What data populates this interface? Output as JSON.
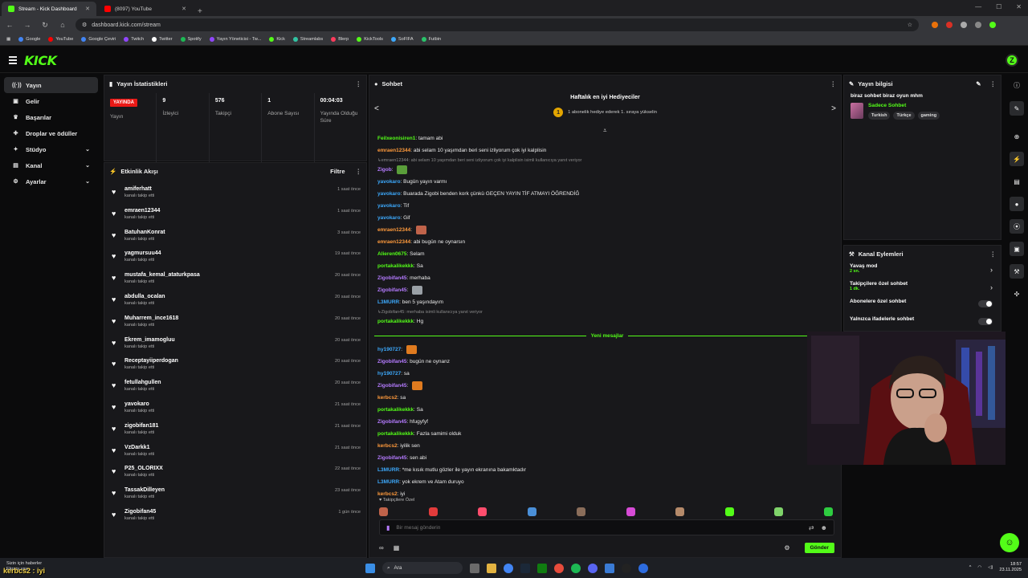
{
  "browser": {
    "tabs": [
      {
        "title": "Stream - Kick Dashboard",
        "color": "#53fc18",
        "active": true
      },
      {
        "title": "(8097) YouTube",
        "color": "#ff0000",
        "active": false
      }
    ],
    "url": "dashboard.kick.com/stream",
    "bookmarks": [
      {
        "label": "Google",
        "color": "#4285f4"
      },
      {
        "label": "YouTube",
        "color": "#ff0000"
      },
      {
        "label": "Google Çeviri",
        "color": "#4285f4"
      },
      {
        "label": "Twitch",
        "color": "#9146ff"
      },
      {
        "label": "Twitter",
        "color": "#ffffff"
      },
      {
        "label": "Spotify",
        "color": "#1db954"
      },
      {
        "label": "Yayın Yöneticisi - Tw...",
        "color": "#9146ff"
      },
      {
        "label": "Kick",
        "color": "#53fc18"
      },
      {
        "label": "Streamlabs",
        "color": "#31c3a2"
      },
      {
        "label": "Blerp",
        "color": "#ff3b5c"
      },
      {
        "label": "KickTools",
        "color": "#53fc18"
      },
      {
        "label": "SoFIFA",
        "color": "#3da9fc"
      },
      {
        "label": "Futbin",
        "color": "#29c36a"
      }
    ]
  },
  "sidebar": {
    "items": [
      {
        "label": "Yayın",
        "icon": "broadcast-icon",
        "symbol": "((·))",
        "active": true,
        "chevron": false
      },
      {
        "label": "Gelir",
        "icon": "revenue-icon",
        "symbol": "▣",
        "active": false,
        "chevron": false
      },
      {
        "label": "Başarılar",
        "icon": "trophy-icon",
        "symbol": "♛",
        "active": false,
        "chevron": false
      },
      {
        "label": "Droplar ve ödüller",
        "icon": "gift-icon",
        "symbol": "✚",
        "active": false,
        "chevron": false
      },
      {
        "label": "Stüdyo",
        "icon": "studio-icon",
        "symbol": "✦",
        "active": false,
        "chevron": true
      },
      {
        "label": "Kanal",
        "icon": "channel-icon",
        "symbol": "▤",
        "active": false,
        "chevron": true
      },
      {
        "label": "Ayarlar",
        "icon": "settings-icon",
        "symbol": "⚙",
        "active": false,
        "chevron": true
      }
    ]
  },
  "stats": {
    "title": "Yayın İstatistikleri",
    "items": [
      {
        "value": "YAYINDA",
        "label": "Yayın",
        "badge": true
      },
      {
        "value": "9",
        "label": "İzleyici",
        "badge": false
      },
      {
        "value": "576",
        "label": "Takipçi",
        "badge": false
      },
      {
        "value": "1",
        "label": "Abone Sayısı",
        "badge": false
      },
      {
        "value": "00:04:03",
        "label": "Yayında Olduğu Süre",
        "badge": false
      }
    ]
  },
  "activity": {
    "title": "Etkinlik Akışı",
    "filter": "Filtre",
    "sub": "kanalı takip etti",
    "rows": [
      {
        "name": "amiferhatt",
        "time": "1 saat önce"
      },
      {
        "name": "emraen12344",
        "time": "1 saat önce"
      },
      {
        "name": "BatuhanKonrat",
        "time": "3 saat önce"
      },
      {
        "name": "yagmursuu44",
        "time": "19 saat önce"
      },
      {
        "name": "mustafa_kemal_ataturkpasa",
        "time": "20 saat önce"
      },
      {
        "name": "abdulla_ocalan",
        "time": "20 saat önce"
      },
      {
        "name": "Muharrem_ince1618",
        "time": "20 saat önce"
      },
      {
        "name": "Ekrem_imamogluu",
        "time": "20 saat önce"
      },
      {
        "name": "Receptayiiperdogan",
        "time": "20 saat önce"
      },
      {
        "name": "fetullahgullen",
        "time": "20 saat önce"
      },
      {
        "name": "yavokaro",
        "time": "21 saat önce"
      },
      {
        "name": "zigobifan181",
        "time": "21 saat önce"
      },
      {
        "name": "VzDarkk1",
        "time": "21 saat önce"
      },
      {
        "name": "P25_OLORIXX",
        "time": "22 saat önce"
      },
      {
        "name": "TassakDilleyen",
        "time": "23 saat önce"
      },
      {
        "name": "Zigobifan45",
        "time": "1 gün önce"
      }
    ]
  },
  "chat": {
    "title": "Sohbet",
    "gifters_title": "Haftalık en iyi Hediyeciler",
    "gifters_rank": "1",
    "gifters_text": "1 abonelik hediye ederek 1. sıraya yükselin",
    "messages": [
      {
        "user": "Feilxeonisiren1",
        "color": "#53fc18",
        "text": "tamam abi"
      },
      {
        "user": "emraen12344",
        "color": "#ff9a3c",
        "text": "abi selam 10 yaşımdan beri seni izliyorum çok iyi kalplisin"
      },
      {
        "reply": "emraen12344: abi selam 10 yaşımdan beri seni izliyorum çok iyi kalplisin isimli kullanıcıya yanıt veriyor"
      },
      {
        "user": "Zigob",
        "color": "#b57bff",
        "text": "",
        "emote": "#5a9e3a"
      },
      {
        "user": "yavokaro",
        "color": "#3da9fc",
        "text": "Bugün yayın varmı"
      },
      {
        "user": "yavokaro",
        "color": "#3da9fc",
        "text": "Buarada Zigobi benden kork çünkü GEÇEN YAYIN TİF ATMAYI ÖĞRENDİĞ"
      },
      {
        "user": "yavokaro",
        "color": "#3da9fc",
        "text": "Tif"
      },
      {
        "user": "yavokaro",
        "color": "#3da9fc",
        "text": "Gif"
      },
      {
        "user": "emraen12344",
        "color": "#ff9a3c",
        "text": "",
        "emote": "#c0634a"
      },
      {
        "user": "emraen12344",
        "color": "#ff9a3c",
        "text": "abi bugün ne oynarsın"
      },
      {
        "user": "Alieren0675",
        "color": "#53fc18",
        "text": "Selam"
      },
      {
        "user": "portakalikekkk",
        "color": "#53fc18",
        "text": "Sa"
      },
      {
        "user": "Zigobifan45",
        "color": "#b57bff",
        "text": "merhaba"
      },
      {
        "user": "Zigobifan45",
        "color": "#b57bff",
        "text": "",
        "emote": "#9aa0a6"
      },
      {
        "user": "L3MURR",
        "color": "#3da9fc",
        "text": "ben 5 yaşındayım"
      },
      {
        "reply": "Zigobifan45: merhaba isimli kullanıcıya yanıt veriyor"
      },
      {
        "user": "portakalikekkk",
        "color": "#53fc18",
        "text": "Hg"
      },
      {
        "separator": "Yeni mesajlar"
      },
      {
        "user": "hy190727",
        "color": "#3da9fc",
        "text": "",
        "emote": "#e07b1f"
      },
      {
        "user": "Zigobifan45",
        "color": "#b57bff",
        "text": "bugün ne oynanz"
      },
      {
        "user": "hy190727",
        "color": "#3da9fc",
        "text": "sa"
      },
      {
        "user": "Zigobifan45",
        "color": "#b57bff",
        "text": "",
        "emote": "#e07b1f"
      },
      {
        "user": "kerbcs2",
        "color": "#ff9a3c",
        "text": "sa"
      },
      {
        "user": "portakalikekkk",
        "color": "#53fc18",
        "text": "Sa"
      },
      {
        "user": "Zigobifan45",
        "color": "#b57bff",
        "text": "hfugyfyf"
      },
      {
        "user": "portakalikekkk",
        "color": "#53fc18",
        "text": "Fazla samimi olduk"
      },
      {
        "user": "kerbcs2",
        "color": "#ff9a3c",
        "text": "iyilik sen"
      },
      {
        "user": "Zigobifan45",
        "color": "#b57bff",
        "text": "sen abi"
      },
      {
        "user": "L3MURR",
        "color": "#3da9fc",
        "text": "*me kısık mutlu gözler ile yayın ekranına bakamktadır"
      },
      {
        "user": "L3MURR",
        "color": "#3da9fc",
        "text": "yok ekrem ve Atam duruyo"
      },
      {
        "user": "kerbcs2",
        "color": "#ff9a3c",
        "text": "iyi"
      }
    ],
    "follow_only": "♥ Takipçilere Özel",
    "emotes": [
      "#c0634a",
      "#e23b3b",
      "#ff4d6d",
      "#4a8fd8",
      "#8a6d5a",
      "#d64bd6",
      "#b58a6a",
      "#53fc18",
      "#7fd36a",
      "#2ecc40"
    ],
    "input_placeholder": "Bir mesaj gönderin",
    "send_label": "Gönder"
  },
  "stream_info": {
    "title": "Yayın bilgisi",
    "stream_title": "biraz sohbet biraz oyun mhm",
    "category": "Sadece Sohbet",
    "tags": [
      "Turkish",
      "Türkçe",
      "gaming"
    ]
  },
  "channel_actions": {
    "title": "Kanal Eylemleri",
    "rows": [
      {
        "label": "Yavaş mod",
        "detail": "2 sn.",
        "kind": "chevron"
      },
      {
        "label": "Takipçilere özel sohbet",
        "detail": "1 dk.",
        "kind": "chevron"
      },
      {
        "label": "Abonelere özel sohbet",
        "detail": "",
        "kind": "toggle"
      },
      {
        "label": "Yalnızca ifadelerle sohbet",
        "detail": "",
        "kind": "toggle"
      }
    ]
  },
  "taskbar": {
    "weather_line1": "Sizin için haberler",
    "weather_line2": "Ekranı yay...",
    "search": "Ara",
    "time": "18:57",
    "date": "23.11.2025",
    "overlay": "kerbcs2 : iyi"
  }
}
